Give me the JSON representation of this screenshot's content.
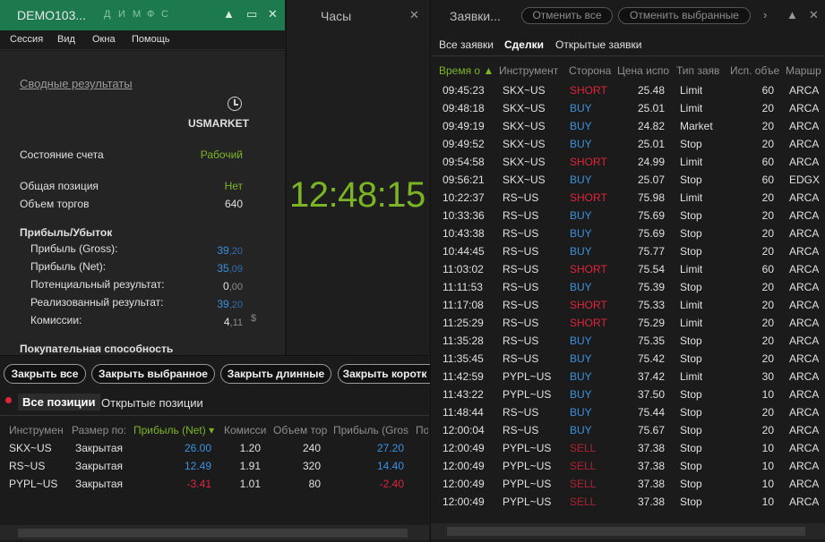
{
  "account": {
    "title": "DEMO103...",
    "title_letters": [
      "Д",
      "И",
      "М",
      "Ф",
      "С"
    ],
    "menu": [
      "Сессия",
      "Вид",
      "Окна",
      "Помощь"
    ],
    "summary_link": "Сводные результаты",
    "market": "USMARKET",
    "rows": {
      "state_label": "Состояние счета",
      "state_value": "Рабочий",
      "position_label": "Общая позиция",
      "position_value": "Нет",
      "volume_label": "Объем торгов",
      "volume_value": "640",
      "pnl_title": "Прибыль/Убыток",
      "gross_label": "Прибыль (Gross):",
      "gross_int": "39",
      "gross_dec": ",20",
      "net_label": "Прибыль (Net):",
      "net_int": "35",
      "net_dec": ",09",
      "potential_label": "Потенциальный результат:",
      "potential_int": "0",
      "potential_dec": ",00",
      "realized_label": "Реализованный результат:",
      "realized_int": "39",
      "realized_dec": ",20",
      "commission_label": "Комиссии:",
      "commission_int": "4",
      "commission_dec": ",11",
      "currency": "$",
      "buying_power": "Покупательная способность"
    }
  },
  "clock": {
    "title": "Часы",
    "time": "12:48:15"
  },
  "positions": {
    "buttons": [
      "Закрыть все",
      "Закрыть выбранное",
      "Закрыть длинные",
      "Закрыть коротк"
    ],
    "tabs": [
      "Все позиции",
      "Открытые позиции"
    ],
    "headers": [
      "Инструмен",
      "Размер по:",
      "Прибыль (Net) ▾",
      "Комисси",
      "Объем тор",
      "Прибыль (Gros",
      "По"
    ],
    "rows": [
      {
        "instrument": "SKX~US",
        "size": "Закрытая",
        "net": "26.00",
        "commission": "1.20",
        "volume": "240",
        "gross": "27.20"
      },
      {
        "instrument": "RS~US",
        "size": "Закрытая",
        "net": "12.49",
        "commission": "1.91",
        "volume": "320",
        "gross": "14.40"
      },
      {
        "instrument": "PYPL~US",
        "size": "Закрытая",
        "net": "-3.41",
        "commission": "1.01",
        "volume": "80",
        "gross": "-2.40"
      }
    ]
  },
  "orders": {
    "title": "Заявки...",
    "buttons": [
      "Отменить все",
      "Отменить выбранные"
    ],
    "tabs": [
      "Все заявки",
      "Сделки",
      "Открытые заявки"
    ],
    "headers": [
      "Время о ▲",
      "Инструмент",
      "Сторона",
      "Цена испо",
      "Тип заяв",
      "Исп. объе",
      "Маршр"
    ],
    "rows": [
      {
        "time": "09:45:23",
        "instrument": "SKX~US",
        "side": "SHORT",
        "price": "25.48",
        "type": "Limit",
        "qty": "60",
        "route": "ARCA"
      },
      {
        "time": "09:48:18",
        "instrument": "SKX~US",
        "side": "BUY",
        "price": "25.01",
        "type": "Limit",
        "qty": "20",
        "route": "ARCA"
      },
      {
        "time": "09:49:19",
        "instrument": "SKX~US",
        "side": "BUY",
        "price": "24.82",
        "type": "Market",
        "qty": "20",
        "route": "ARCA"
      },
      {
        "time": "09:49:52",
        "instrument": "SKX~US",
        "side": "BUY",
        "price": "25.01",
        "type": "Stop",
        "qty": "20",
        "route": "ARCA"
      },
      {
        "time": "09:54:58",
        "instrument": "SKX~US",
        "side": "SHORT",
        "price": "24.99",
        "type": "Limit",
        "qty": "60",
        "route": "ARCA"
      },
      {
        "time": "09:56:21",
        "instrument": "SKX~US",
        "side": "BUY",
        "price": "25.07",
        "type": "Stop",
        "qty": "60",
        "route": "EDGX"
      },
      {
        "time": "10:22:37",
        "instrument": "RS~US",
        "side": "SHORT",
        "price": "75.98",
        "type": "Limit",
        "qty": "20",
        "route": "ARCA"
      },
      {
        "time": "10:33:36",
        "instrument": "RS~US",
        "side": "BUY",
        "price": "75.69",
        "type": "Stop",
        "qty": "20",
        "route": "ARCA"
      },
      {
        "time": "10:43:38",
        "instrument": "RS~US",
        "side": "BUY",
        "price": "75.69",
        "type": "Stop",
        "qty": "20",
        "route": "ARCA"
      },
      {
        "time": "10:44:45",
        "instrument": "RS~US",
        "side": "BUY",
        "price": "75.77",
        "type": "Stop",
        "qty": "20",
        "route": "ARCA"
      },
      {
        "time": "11:03:02",
        "instrument": "RS~US",
        "side": "SHORT",
        "price": "75.54",
        "type": "Limit",
        "qty": "60",
        "route": "ARCA"
      },
      {
        "time": "11:11:53",
        "instrument": "RS~US",
        "side": "BUY",
        "price": "75.39",
        "type": "Stop",
        "qty": "20",
        "route": "ARCA"
      },
      {
        "time": "11:17:08",
        "instrument": "RS~US",
        "side": "SHORT",
        "price": "75.33",
        "type": "Limit",
        "qty": "20",
        "route": "ARCA"
      },
      {
        "time": "11:25:29",
        "instrument": "RS~US",
        "side": "SHORT",
        "price": "75.29",
        "type": "Limit",
        "qty": "20",
        "route": "ARCA"
      },
      {
        "time": "11:35:28",
        "instrument": "RS~US",
        "side": "BUY",
        "price": "75.35",
        "type": "Stop",
        "qty": "20",
        "route": "ARCA"
      },
      {
        "time": "11:35:45",
        "instrument": "RS~US",
        "side": "BUY",
        "price": "75.42",
        "type": "Stop",
        "qty": "20",
        "route": "ARCA"
      },
      {
        "time": "11:42:59",
        "instrument": "PYPL~US",
        "side": "BUY",
        "price": "37.42",
        "type": "Limit",
        "qty": "30",
        "route": "ARCA"
      },
      {
        "time": "11:43:22",
        "instrument": "PYPL~US",
        "side": "BUY",
        "price": "37.50",
        "type": "Stop",
        "qty": "10",
        "route": "ARCA"
      },
      {
        "time": "11:48:44",
        "instrument": "RS~US",
        "side": "BUY",
        "price": "75.44",
        "type": "Stop",
        "qty": "20",
        "route": "ARCA"
      },
      {
        "time": "12:00:04",
        "instrument": "RS~US",
        "side": "BUY",
        "price": "75.67",
        "type": "Stop",
        "qty": "20",
        "route": "ARCA"
      },
      {
        "time": "12:00:49",
        "instrument": "PYPL~US",
        "side": "SELL",
        "price": "37.38",
        "type": "Stop",
        "qty": "10",
        "route": "ARCA"
      },
      {
        "time": "12:00:49",
        "instrument": "PYPL~US",
        "side": "SELL",
        "price": "37.38",
        "type": "Stop",
        "qty": "10",
        "route": "ARCA"
      },
      {
        "time": "12:00:49",
        "instrument": "PYPL~US",
        "side": "SELL",
        "price": "37.38",
        "type": "Stop",
        "qty": "10",
        "route": "ARCA"
      },
      {
        "time": "12:00:49",
        "instrument": "PYPL~US",
        "side": "SELL",
        "price": "37.38",
        "type": "Stop",
        "qty": "10",
        "route": "ARCA"
      }
    ]
  },
  "colors": {
    "green": "#7cb524",
    "blue": "#3a92e0",
    "red": "#e0243a",
    "title_green": "#1d7a4e"
  }
}
